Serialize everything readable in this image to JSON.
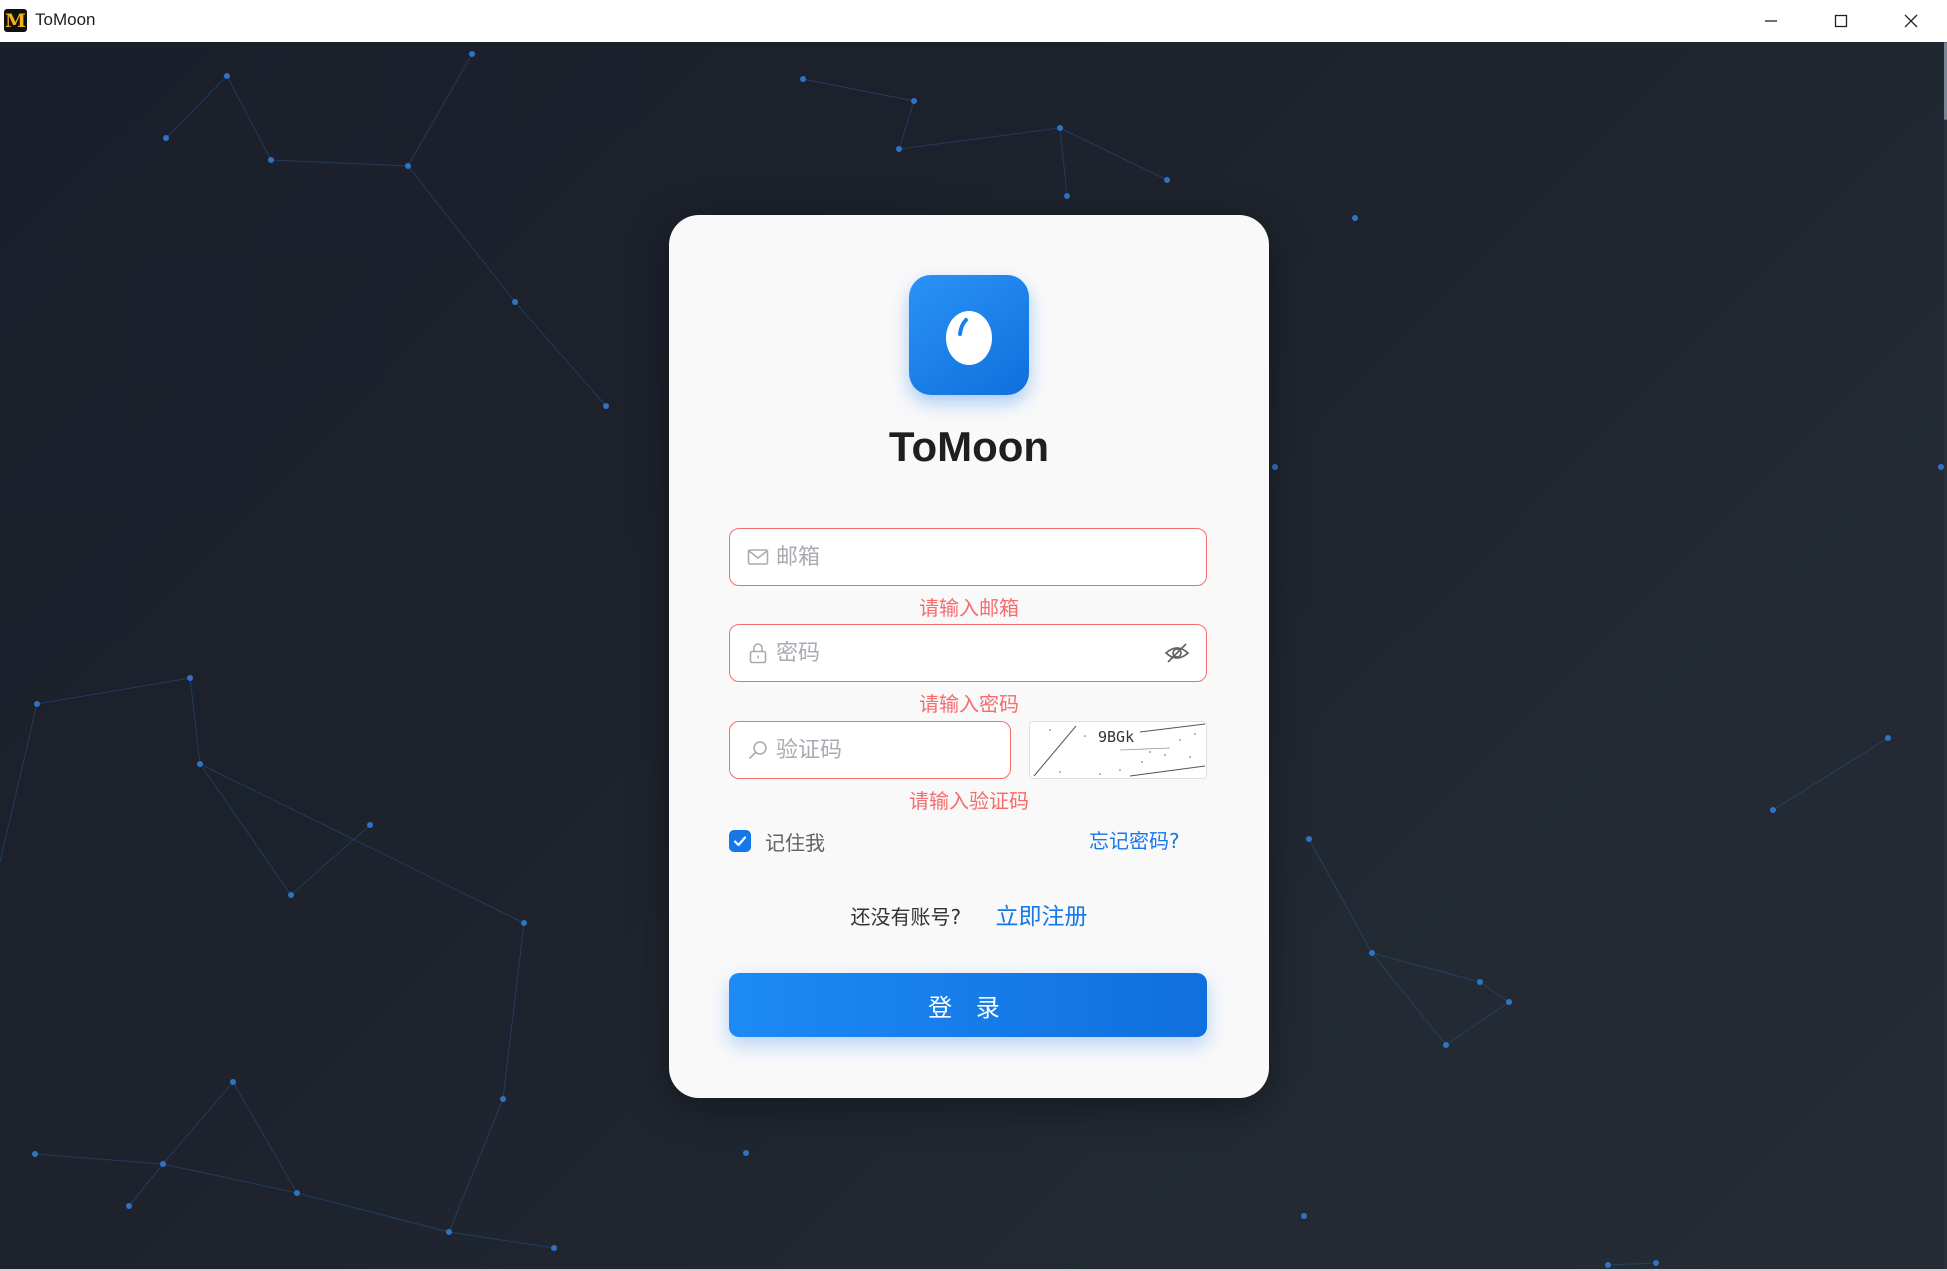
{
  "window": {
    "title": "ToMoon",
    "app_icon_letter": "M"
  },
  "card": {
    "app_name": "ToMoon",
    "email": {
      "placeholder": "邮箱",
      "value": "",
      "error": "请输入邮箱"
    },
    "password": {
      "placeholder": "密码",
      "value": "",
      "error": "请输入密码"
    },
    "captcha": {
      "placeholder": "验证码",
      "value": "",
      "error": "请输入验证码",
      "image_text": "9BGk"
    },
    "remember": {
      "label": "记住我",
      "checked": true
    },
    "forgot_label": "忘记密码?",
    "signup_prompt": "还没有账号?",
    "signup_link": "立即注册",
    "login_label": "登 录"
  },
  "colors": {
    "accent": "#1677e8",
    "error": "#f56c6c",
    "background": "#1d222c",
    "card": "#f9f9fa"
  },
  "icons": [
    "mail-icon",
    "lock-icon",
    "search-icon",
    "eye-off-icon",
    "check-icon",
    "egg-logo-icon",
    "minimize-icon",
    "maximize-icon",
    "close-icon"
  ]
}
